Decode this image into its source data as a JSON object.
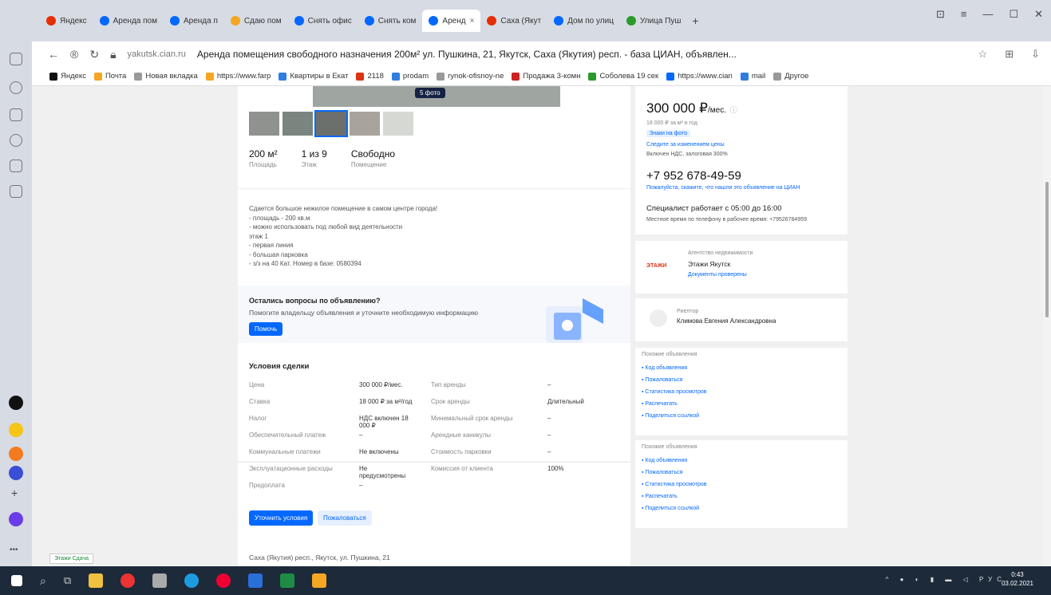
{
  "browser": {
    "tabs": [
      {
        "label": "Яндекс",
        "color": "#e62e04"
      },
      {
        "label": "Аренда пом",
        "color": "#0468ff"
      },
      {
        "label": "Аренда п",
        "color": "#0468ff"
      },
      {
        "label": "Сдаю пом",
        "color": "#f5a623"
      },
      {
        "label": "Снять офис",
        "color": "#0468ff"
      },
      {
        "label": "Снять ком",
        "color": "#0468ff"
      },
      {
        "label": "Аренд",
        "color": "#0468ff",
        "active": true
      },
      {
        "label": "Саха (Якут",
        "color": "#e62e04"
      },
      {
        "label": "Дом по улиц",
        "color": "#0468ff"
      },
      {
        "label": "Улица Пуш",
        "color": "#2b9a2b"
      }
    ],
    "new_tab": "+",
    "window_controls": [
      "⊡",
      "≡",
      "—",
      "☐",
      "✕"
    ],
    "address_domain": "yakutsk.cian.ru",
    "address_title": "Аренда помещения свободного назначения 200м² ул. Пушкина, 21, Якутск, Саха (Якутия) респ. - база ЦИАН, объявлен...",
    "bookmarks": [
      {
        "label": "Яндекс",
        "color": "#111"
      },
      {
        "label": "Почта",
        "color": "#f5a623"
      },
      {
        "label": "Новая вкладка",
        "color": "#999"
      },
      {
        "label": "https://www.farp",
        "color": "#f5a623"
      },
      {
        "label": "Квартиры в Екат",
        "color": "#2f7de1"
      },
      {
        "label": "2118",
        "color": "#d31"
      },
      {
        "label": "prodam",
        "color": "#2f7de1"
      },
      {
        "label": "rynok-ofisnoy-ne",
        "color": "#999"
      },
      {
        "label": "Продажа 3-комн",
        "color": "#c22"
      },
      {
        "label": "Соболева 19 сек",
        "color": "#2b9a2b"
      },
      {
        "label": "https://www.cian",
        "color": "#0468ff"
      },
      {
        "label": "mail",
        "color": "#2f7de1"
      },
      {
        "label": "Другое",
        "color": "#999"
      }
    ]
  },
  "listing": {
    "photo_count": "5 фото",
    "stats": [
      {
        "value": "200 м²",
        "label": "Площадь"
      },
      {
        "value": "1 из 9",
        "label": "Этаж"
      },
      {
        "value": "Свободно",
        "label": "Помещение"
      }
    ],
    "description": [
      "Сдается большое нежилое помещение в самом центре города!",
      "- площадь - 200 кв.м",
      "- можно использовать под любой вид деятельности",
      "  этаж 1",
      "- первая линия",
      "- большая парковка",
      "- з/з на 40 Кат. Номер в базе: 0580394"
    ],
    "ask_title": "Остались вопросы по объявлению?",
    "ask_sub": "Помогите владельцу объявления и уточните необходимую информацию",
    "ask_button": "Помочь",
    "conditions_title": "Условия сделки",
    "conditions_left": [
      {
        "label": "Цена",
        "value": "300 000 ₽/мес."
      },
      {
        "label": "Ставка",
        "value": "18 000 ₽ за м²/год"
      },
      {
        "label": "Налог",
        "value": "НДС включен 18 000 ₽"
      },
      {
        "label": "Обеспечительный платеж",
        "value": ""
      },
      {
        "label": "Коммунальные платежи",
        "value": "Не включены"
      },
      {
        "label": "Эксплуатационные расходы",
        "value": "Не предусмотрены"
      },
      {
        "label": "Предоплата",
        "value": ""
      }
    ],
    "conditions_right": [
      {
        "label": "Тип аренды",
        "value": ""
      },
      {
        "label": "Срок аренды",
        "value": "Длительный"
      },
      {
        "label": "Минимальный срок аренды",
        "value": ""
      },
      {
        "label": "Арендные каникулы",
        "value": ""
      },
      {
        "label": "Стоимость парковки",
        "value": ""
      },
      {
        "label": "Комиссия от клиента",
        "value": "100%"
      }
    ],
    "button_conditions": "Уточнить условия",
    "button_similar": "Пожаловаться",
    "address": "Саха (Якутия) респ., Якутск, ул. Пушкина, 21"
  },
  "sidebar": {
    "price": "300 000 ₽",
    "price_unit": "/мес.",
    "price_sub": "18 000 ₽ за м² в год",
    "badge": "Знаки на фото",
    "line1": "Следите за изменением цены",
    "line2": "Включен НДС, залоговая 300%",
    "phone": "+7 952 678-49-59",
    "phone_note": "Пожалуйста, скажите, что нашли это объявление на ЦИАН",
    "schedule": "Специалист работает с 05:00 до 16:00",
    "schedule_note": "Местное время по телефону в рабочее время: +79526784959",
    "agency_label": "Агентство недвижимости",
    "agency_name": "Этажи Якутск",
    "agency_logo": "ЭТАЖИ",
    "agency_check": "Документы проверены",
    "realtor_label": "Риелтор",
    "realtor_name": "Климова Евгения Александровна",
    "panel1_title": "Похожие объявления",
    "panel1_items": [
      "Код объявления",
      "Пожаловаться",
      "Статистика просмотров",
      "Распечатать",
      "Поделиться ссылкой"
    ],
    "panel2_title": "Похожие объявления",
    "panel2_items": [
      "Код объявления",
      "Пожаловаться",
      "Статистика просмотров",
      "Распечатать",
      "Поделиться ссылкой"
    ]
  },
  "misc": {
    "green_tab": "Этажи Сдача"
  },
  "taskbar": {
    "time": "0:43",
    "date": "03.02.2021",
    "lang": "РУС"
  }
}
